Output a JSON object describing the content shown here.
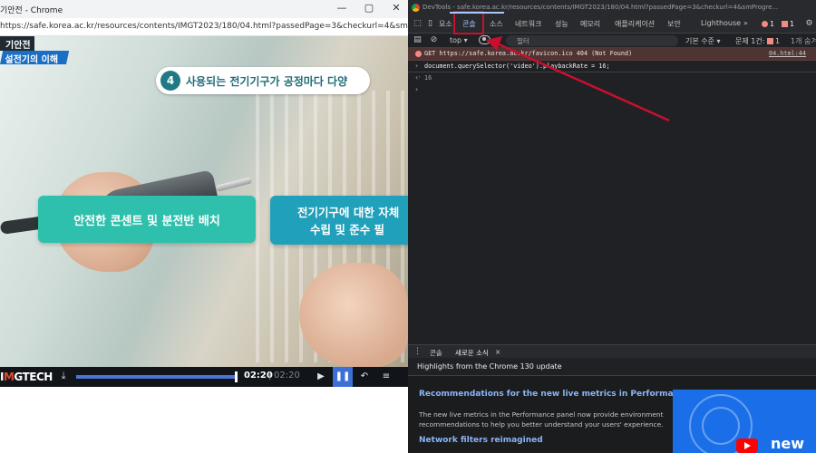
{
  "chrome": {
    "title": "기안전 - Chrome",
    "url": "https://safe.korea.ac.kr/resources/contents/IMGT2023/180/04.html?passedPage=3&checkurl=4&smProgressN...",
    "window_controls": {
      "minimize": "—",
      "maximize": "▢",
      "close": "✕"
    }
  },
  "video": {
    "logo_line1": "기안전",
    "logo_line2": "설전기의 이해",
    "badge_number": "4",
    "badge_text": "사용되는 전기기구가 공정마다 다양",
    "card1_text": "안전한 콘센트 및 분전반 배치",
    "card2_line1": "전기기구에 대한 자체",
    "card2_line2": "수립 및 준수 필",
    "controls": {
      "brand_prefix": "I",
      "brand_m": "M",
      "brand_rest": "GTECH",
      "current_time": "02:20",
      "separator": "|",
      "total_time": "02:20",
      "progress": 1.0,
      "play_icon": "▶",
      "pause_icon": "❚❚",
      "replay_icon": "↶",
      "menu_icon": "≡",
      "download_icon": "⤓"
    }
  },
  "devtools": {
    "title": "DevTools - safe.korea.ac.kr/resources/contents/IMGT2023/180/04.html?passedPage=3&checkurl=4&smProgre...",
    "tabs": [
      "요소",
      "콘솔",
      "소스",
      "네트워크",
      "성능",
      "메모리",
      "애플리케이션",
      "보안",
      "Lighthouse"
    ],
    "more_tabs": "»",
    "error_count": "1",
    "issue_count": "1",
    "toolbar": {
      "context": "top ▾",
      "filter_placeholder": "필터",
      "levels": "기본 수준 ▾",
      "issues": "문제 1건:",
      "issues_count": "1",
      "hidden": "1개 숨겨"
    },
    "console": {
      "error_msg": "GET https://safe.korea.ac.kr/favicon.ico 404 (Not Found)",
      "error_src": "04.html:44",
      "input": "document.querySelector('video').playbackRate = 16;",
      "output": "16"
    },
    "drawer": {
      "tabs": [
        "콘솔",
        "새로운 소식"
      ],
      "close": "×",
      "highlights": "Highlights from the Chrome 130 update",
      "news_h1": "Recommendations for the new live metrics in Performance",
      "news_p1": "The new live metrics in the Performance panel now provide environment recommendations to help you better understand your users' experience.",
      "news_h2": "Network filters reimagined",
      "thumb_text": "new"
    },
    "colors": {
      "accent": "#a8c7fa",
      "highlight_box": "#c8102e",
      "error_bg": "#4e3534"
    }
  }
}
